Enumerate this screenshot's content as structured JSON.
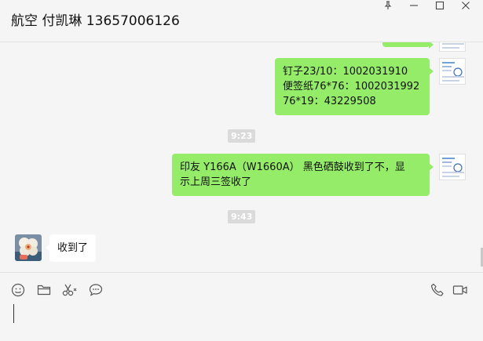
{
  "window": {
    "title": "航空 付凯琳 13657006126",
    "controls": [
      "pin-icon",
      "minimize-icon",
      "maximize-icon",
      "close-icon"
    ]
  },
  "messages": [
    {
      "side": "right",
      "type": "text",
      "lines": [
        "钉子23/10：1002031910",
        "便签纸76*76：1002031992",
        "76*19：43229508"
      ]
    },
    {
      "type": "time",
      "text": "9:23"
    },
    {
      "side": "right",
      "type": "text",
      "lines": [
        " 印友 Y166A（W1660A） 黑色硒鼓收到了不，显",
        "示上周三签收了"
      ]
    },
    {
      "type": "time",
      "text": "9:43"
    },
    {
      "side": "left",
      "type": "text",
      "lines": [
        "收到了"
      ]
    }
  ],
  "toolbar": {
    "left_icons": [
      "emoji-icon",
      "folder-icon",
      "scissors-icon",
      "chat-bubble-icon"
    ],
    "right_icons": [
      "phone-icon",
      "video-call-icon"
    ]
  },
  "input": {
    "value": ""
  }
}
